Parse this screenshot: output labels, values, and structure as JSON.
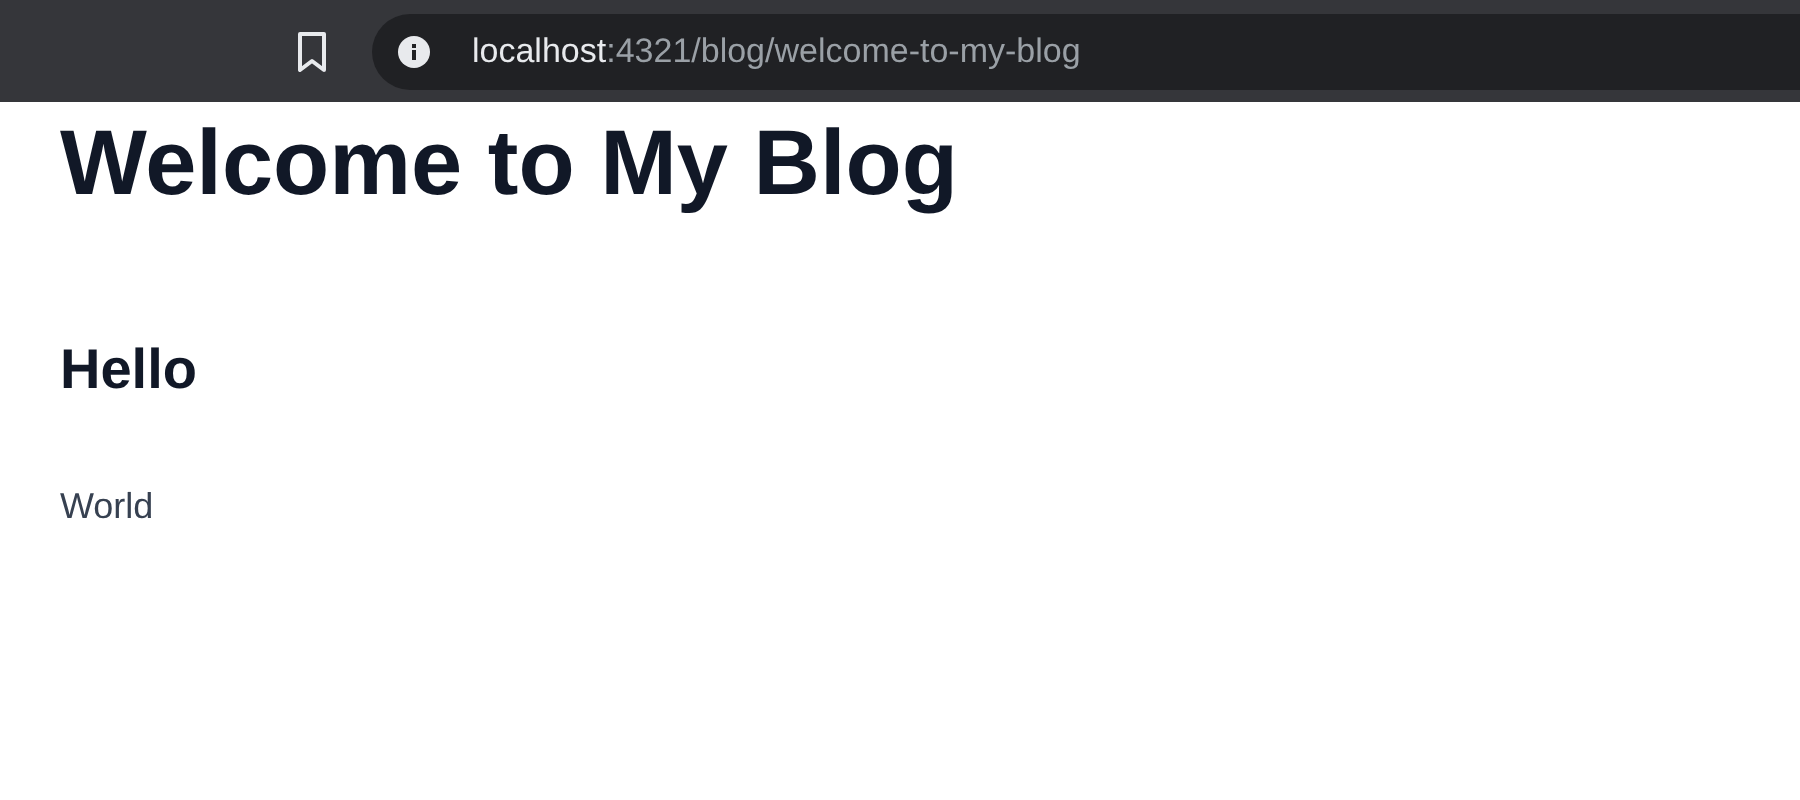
{
  "browser": {
    "address": {
      "host": "localhost",
      "path": ":4321/blog/welcome-to-my-blog"
    }
  },
  "page": {
    "title": "Welcome to My Blog",
    "heading": "Hello",
    "paragraph": "World"
  }
}
